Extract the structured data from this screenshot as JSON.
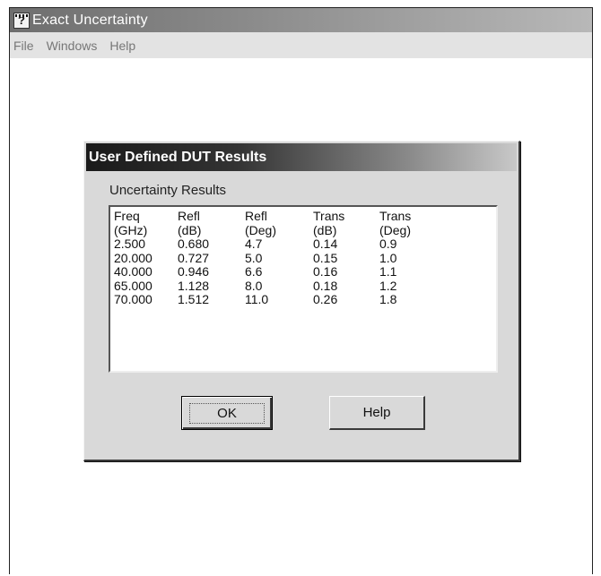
{
  "window": {
    "title": "Exact Uncertainty",
    "icon_glyph": "?"
  },
  "menu": {
    "items": [
      "File",
      "Windows",
      "Help"
    ]
  },
  "dialog": {
    "title": "User Defined DUT Results",
    "group_label": "Uncertainty Results",
    "table": {
      "headers": [
        [
          "Freq",
          "Refl",
          "Refl",
          "Trans",
          "Trans"
        ],
        [
          "(GHz)",
          "(dB)",
          "(Deg)",
          "(dB)",
          "(Deg)"
        ]
      ],
      "rows": [
        [
          "2.500",
          "0.680",
          "4.7",
          "0.14",
          "0.9"
        ],
        [
          "20.000",
          "0.727",
          "5.0",
          "0.15",
          "1.0"
        ],
        [
          "40.000",
          "0.946",
          "6.6",
          "0.16",
          "1.1"
        ],
        [
          "65.000",
          "1.128",
          "8.0",
          "0.18",
          "1.2"
        ],
        [
          "70.000",
          "1.512",
          "11.0",
          "0.26",
          "1.8"
        ]
      ]
    },
    "ok_label": "OK",
    "help_label": "Help"
  }
}
